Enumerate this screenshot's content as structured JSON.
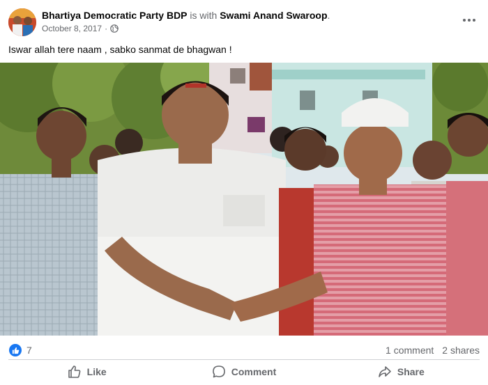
{
  "post": {
    "author": "Bhartiya Democratic Party BDP",
    "with_text": "is with",
    "tagged": "Swami Anand Swaroop",
    "tagged_suffix": ".",
    "date": "October 8, 2017",
    "separator": "·",
    "privacy_icon": "globe-icon",
    "more_icon": "more-horizontal-icon",
    "text": "Iswar allah tere naam , sabko sanmat de bhagwan !"
  },
  "stats": {
    "reaction_icon": "like-reaction-icon",
    "reaction_count": "7",
    "comments": "1 comment",
    "shares": "2 shares"
  },
  "actions": {
    "like": "Like",
    "comment": "Comment",
    "share": "Share"
  },
  "colors": {
    "accent": "#1877f2",
    "muted": "#65676b",
    "divider": "#ced0d4"
  }
}
